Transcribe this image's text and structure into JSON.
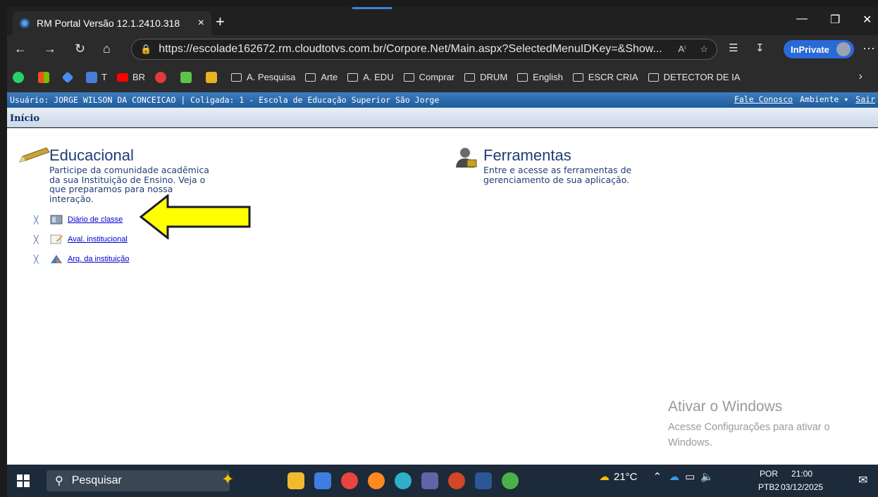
{
  "browser": {
    "tab_title": "RM Portal Versão 12.1.2410.318",
    "tab_close": "×",
    "new_tab": "+",
    "url": "https://escolade162672.rm.cloudtotvs.com.br/Corpore.Net/Main.aspx?SelectedMenuIDKey=&Show...",
    "inprivate_label": "InPrivate",
    "bookmarks": [
      {
        "label": "T"
      },
      {
        "label": "BR"
      },
      {
        "label": "A. Pesquisa"
      },
      {
        "label": "Arte"
      },
      {
        "label": "A. EDU"
      },
      {
        "label": "Comprar"
      },
      {
        "label": "DRUM"
      },
      {
        "label": "English"
      },
      {
        "label": "ESCR CRIA"
      },
      {
        "label": "DETECTOR DE IA"
      }
    ]
  },
  "portal": {
    "user_info": "Usuário: JORGE WILSON DA CONCEICAO | Coligada: 1 - Escola de Educação Superior São Jorge",
    "contact_link": "Fale Conosco",
    "environment_menu": "Ambiente ▾",
    "logout_link": "Sair",
    "breadcrumb": "Início"
  },
  "educacional": {
    "title": "Educacional",
    "description": [
      "Participe da comunidade acadêmica",
      "da sua Instituição de Ensino. Veja o",
      "que preparamos para nossa",
      "interação."
    ],
    "links": [
      {
        "label": "Diário de classe"
      },
      {
        "label": "Aval. institucional"
      },
      {
        "label": "Arq. da instituição"
      }
    ]
  },
  "ferramentas": {
    "title": "Ferramentas",
    "description": [
      "Entre e acesse as ferramentas de",
      "gerenciamento de sua aplicação."
    ]
  },
  "watermark": {
    "title": "Ativar o Windows",
    "line1": "Acesse Configurações para ativar o",
    "line2": "Windows."
  },
  "taskbar": {
    "search_placeholder": "Pesquisar",
    "temperature": "21°C",
    "lang_top": "POR",
    "lang_bottom": "PTB2",
    "time": "21:00",
    "date": "03/12/2025"
  },
  "colors": {
    "arrow_fill": "#ffff00",
    "header_blue": "#1d5b9c",
    "link_blue": "#0000cc"
  }
}
